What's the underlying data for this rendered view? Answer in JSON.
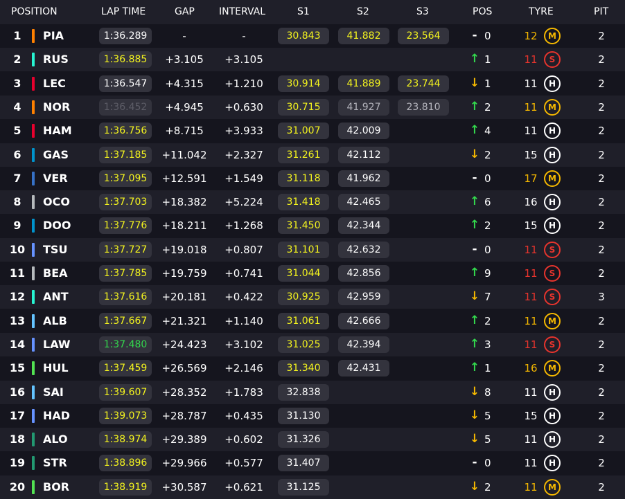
{
  "headers": {
    "position": "POSITION",
    "lap_time": "LAP TIME",
    "gap": "GAP",
    "interval": "INTERVAL",
    "s1": "S1",
    "s2": "S2",
    "s3": "S3",
    "pos": "POS",
    "tyre": "TYRE",
    "pit": "PIT"
  },
  "colors": {
    "background": "#15151e",
    "row_alt": "#1f1f29",
    "cell_bg": "#33333d",
    "yellow": "#f4f41e",
    "green": "#33d94d",
    "orange_down": "#f5b800",
    "soft_red": "#e8342d",
    "medium_yellow": "#f5b800",
    "hard_white": "#ffffff"
  },
  "rows": [
    {
      "pos": "1",
      "code": "PIA",
      "team_color": "#ff8000",
      "lap": "1:36.289",
      "lap_color": "white",
      "gap": "-",
      "interval": "-",
      "s1": "30.843",
      "s1c": "yellow",
      "s2": "41.882",
      "s2c": "yellow",
      "s3": "23.564",
      "s3c": "yellow",
      "dir": "same",
      "chg": "0",
      "age": "12",
      "age_color": "#f5b800",
      "tyre": "M",
      "tyre_color": "#f5b800",
      "pit": "2"
    },
    {
      "pos": "2",
      "code": "RUS",
      "team_color": "#27f4d2",
      "lap": "1:36.885",
      "lap_color": "yellow",
      "gap": "+3.105",
      "interval": "+3.105",
      "s1": "",
      "s1c": "white",
      "s2": "",
      "s2c": "white",
      "s3": "",
      "s3c": "white",
      "dir": "up",
      "chg": "1",
      "age": "11",
      "age_color": "#e8342d",
      "tyre": "S",
      "tyre_color": "#e8342d",
      "pit": "2"
    },
    {
      "pos": "3",
      "code": "LEC",
      "team_color": "#e8002d",
      "lap": "1:36.547",
      "lap_color": "white",
      "gap": "+4.315",
      "interval": "+1.210",
      "s1": "30.914",
      "s1c": "yellow",
      "s2": "41.889",
      "s2c": "yellow",
      "s3": "23.744",
      "s3c": "yellow",
      "dir": "down",
      "chg": "1",
      "age": "11",
      "age_color": "#ffffff",
      "tyre": "H",
      "tyre_color": "#ffffff",
      "pit": "2"
    },
    {
      "pos": "4",
      "code": "NOR",
      "team_color": "#ff8000",
      "lap": "1:36.452",
      "lap_color": "grey",
      "gap": "+4.945",
      "interval": "+0.630",
      "s1": "30.715",
      "s1c": "yellow",
      "s2": "41.927",
      "s2c": "grey",
      "s3": "23.810",
      "s3c": "grey",
      "dir": "up",
      "chg": "2",
      "age": "11",
      "age_color": "#f5b800",
      "tyre": "M",
      "tyre_color": "#f5b800",
      "pit": "2"
    },
    {
      "pos": "5",
      "code": "HAM",
      "team_color": "#e8002d",
      "lap": "1:36.756",
      "lap_color": "yellow",
      "gap": "+8.715",
      "interval": "+3.933",
      "s1": "31.007",
      "s1c": "yellow",
      "s2": "42.009",
      "s2c": "white",
      "s3": "",
      "s3c": "white",
      "dir": "up",
      "chg": "4",
      "age": "11",
      "age_color": "#ffffff",
      "tyre": "H",
      "tyre_color": "#ffffff",
      "pit": "2"
    },
    {
      "pos": "6",
      "code": "GAS",
      "team_color": "#0093cc",
      "lap": "1:37.185",
      "lap_color": "yellow",
      "gap": "+11.042",
      "interval": "+2.327",
      "s1": "31.261",
      "s1c": "yellow",
      "s2": "42.112",
      "s2c": "white",
      "s3": "",
      "s3c": "white",
      "dir": "down",
      "chg": "2",
      "age": "15",
      "age_color": "#ffffff",
      "tyre": "H",
      "tyre_color": "#ffffff",
      "pit": "2"
    },
    {
      "pos": "7",
      "code": "VER",
      "team_color": "#3671c6",
      "lap": "1:37.095",
      "lap_color": "yellow",
      "gap": "+12.591",
      "interval": "+1.549",
      "s1": "31.118",
      "s1c": "yellow",
      "s2": "41.962",
      "s2c": "white",
      "s3": "",
      "s3c": "white",
      "dir": "same",
      "chg": "0",
      "age": "17",
      "age_color": "#f5b800",
      "tyre": "M",
      "tyre_color": "#f5b800",
      "pit": "2"
    },
    {
      "pos": "8",
      "code": "OCO",
      "team_color": "#b6babd",
      "lap": "1:37.703",
      "lap_color": "yellow",
      "gap": "+18.382",
      "interval": "+5.224",
      "s1": "31.418",
      "s1c": "yellow",
      "s2": "42.465",
      "s2c": "white",
      "s3": "",
      "s3c": "white",
      "dir": "up",
      "chg": "6",
      "age": "16",
      "age_color": "#ffffff",
      "tyre": "H",
      "tyre_color": "#ffffff",
      "pit": "2"
    },
    {
      "pos": "9",
      "code": "DOO",
      "team_color": "#0093cc",
      "lap": "1:37.776",
      "lap_color": "yellow",
      "gap": "+18.211",
      "interval": "+1.268",
      "s1": "31.450",
      "s1c": "yellow",
      "s2": "42.344",
      "s2c": "white",
      "s3": "",
      "s3c": "white",
      "dir": "up",
      "chg": "2",
      "age": "15",
      "age_color": "#ffffff",
      "tyre": "H",
      "tyre_color": "#ffffff",
      "pit": "2"
    },
    {
      "pos": "10",
      "code": "TSU",
      "team_color": "#6692ff",
      "lap": "1:37.727",
      "lap_color": "yellow",
      "gap": "+19.018",
      "interval": "+0.807",
      "s1": "31.101",
      "s1c": "yellow",
      "s2": "42.632",
      "s2c": "white",
      "s3": "",
      "s3c": "white",
      "dir": "same",
      "chg": "0",
      "age": "11",
      "age_color": "#e8342d",
      "tyre": "S",
      "tyre_color": "#e8342d",
      "pit": "2"
    },
    {
      "pos": "11",
      "code": "BEA",
      "team_color": "#b6babd",
      "lap": "1:37.785",
      "lap_color": "yellow",
      "gap": "+19.759",
      "interval": "+0.741",
      "s1": "31.044",
      "s1c": "yellow",
      "s2": "42.856",
      "s2c": "white",
      "s3": "",
      "s3c": "white",
      "dir": "up",
      "chg": "9",
      "age": "11",
      "age_color": "#e8342d",
      "tyre": "S",
      "tyre_color": "#e8342d",
      "pit": "2"
    },
    {
      "pos": "12",
      "code": "ANT",
      "team_color": "#27f4d2",
      "lap": "1:37.616",
      "lap_color": "yellow",
      "gap": "+20.181",
      "interval": "+0.422",
      "s1": "30.925",
      "s1c": "yellow",
      "s2": "42.959",
      "s2c": "white",
      "s3": "",
      "s3c": "white",
      "dir": "down",
      "chg": "7",
      "age": "11",
      "age_color": "#e8342d",
      "tyre": "S",
      "tyre_color": "#e8342d",
      "pit": "3"
    },
    {
      "pos": "13",
      "code": "ALB",
      "team_color": "#64c4ff",
      "lap": "1:37.667",
      "lap_color": "yellow",
      "gap": "+21.321",
      "interval": "+1.140",
      "s1": "31.061",
      "s1c": "yellow",
      "s2": "42.666",
      "s2c": "white",
      "s3": "",
      "s3c": "white",
      "dir": "up",
      "chg": "2",
      "age": "11",
      "age_color": "#f5b800",
      "tyre": "M",
      "tyre_color": "#f5b800",
      "pit": "2"
    },
    {
      "pos": "14",
      "code": "LAW",
      "team_color": "#6692ff",
      "lap": "1:37.480",
      "lap_color": "green",
      "gap": "+24.423",
      "interval": "+3.102",
      "s1": "31.025",
      "s1c": "yellow",
      "s2": "42.394",
      "s2c": "white",
      "s3": "",
      "s3c": "white",
      "dir": "up",
      "chg": "3",
      "age": "11",
      "age_color": "#e8342d",
      "tyre": "S",
      "tyre_color": "#e8342d",
      "pit": "2"
    },
    {
      "pos": "15",
      "code": "HUL",
      "team_color": "#52e252",
      "lap": "1:37.459",
      "lap_color": "yellow",
      "gap": "+26.569",
      "interval": "+2.146",
      "s1": "31.340",
      "s1c": "yellow",
      "s2": "42.431",
      "s2c": "white",
      "s3": "",
      "s3c": "white",
      "dir": "up",
      "chg": "1",
      "age": "16",
      "age_color": "#f5b800",
      "tyre": "M",
      "tyre_color": "#f5b800",
      "pit": "2"
    },
    {
      "pos": "16",
      "code": "SAI",
      "team_color": "#64c4ff",
      "lap": "1:39.607",
      "lap_color": "yellow",
      "gap": "+28.352",
      "interval": "+1.783",
      "s1": "32.838",
      "s1c": "white",
      "s2": "",
      "s2c": "white",
      "s3": "",
      "s3c": "white",
      "dir": "down",
      "chg": "8",
      "age": "11",
      "age_color": "#ffffff",
      "tyre": "H",
      "tyre_color": "#ffffff",
      "pit": "2"
    },
    {
      "pos": "17",
      "code": "HAD",
      "team_color": "#6692ff",
      "lap": "1:39.073",
      "lap_color": "yellow",
      "gap": "+28.787",
      "interval": "+0.435",
      "s1": "31.130",
      "s1c": "white",
      "s2": "",
      "s2c": "white",
      "s3": "",
      "s3c": "white",
      "dir": "down",
      "chg": "5",
      "age": "15",
      "age_color": "#ffffff",
      "tyre": "H",
      "tyre_color": "#ffffff",
      "pit": "2"
    },
    {
      "pos": "18",
      "code": "ALO",
      "team_color": "#229971",
      "lap": "1:38.974",
      "lap_color": "yellow",
      "gap": "+29.389",
      "interval": "+0.602",
      "s1": "31.326",
      "s1c": "white",
      "s2": "",
      "s2c": "white",
      "s3": "",
      "s3c": "white",
      "dir": "down",
      "chg": "5",
      "age": "11",
      "age_color": "#ffffff",
      "tyre": "H",
      "tyre_color": "#ffffff",
      "pit": "2"
    },
    {
      "pos": "19",
      "code": "STR",
      "team_color": "#229971",
      "lap": "1:38.896",
      "lap_color": "yellow",
      "gap": "+29.966",
      "interval": "+0.577",
      "s1": "31.407",
      "s1c": "white",
      "s2": "",
      "s2c": "white",
      "s3": "",
      "s3c": "white",
      "dir": "same",
      "chg": "0",
      "age": "11",
      "age_color": "#ffffff",
      "tyre": "H",
      "tyre_color": "#ffffff",
      "pit": "2"
    },
    {
      "pos": "20",
      "code": "BOR",
      "team_color": "#52e252",
      "lap": "1:38.919",
      "lap_color": "yellow",
      "gap": "+30.587",
      "interval": "+0.621",
      "s1": "31.125",
      "s1c": "white",
      "s2": "",
      "s2c": "white",
      "s3": "",
      "s3c": "white",
      "dir": "down",
      "chg": "2",
      "age": "11",
      "age_color": "#f5b800",
      "tyre": "M",
      "tyre_color": "#f5b800",
      "pit": "2"
    }
  ]
}
